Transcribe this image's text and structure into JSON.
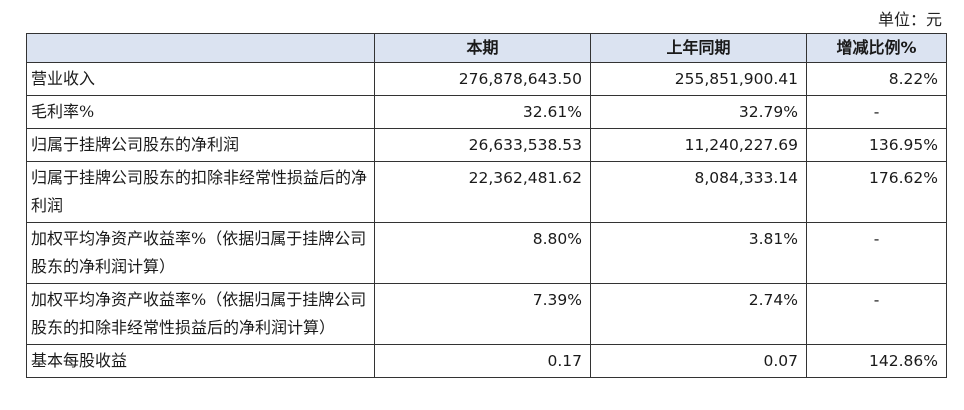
{
  "unit_label": "单位：元",
  "table": {
    "headers": [
      "",
      "本期",
      "上年同期",
      "增减比例%"
    ],
    "rows": [
      {
        "label": "营业收入",
        "current": "276,878,643.50",
        "prior": "255,851,900.41",
        "change": "8.22%"
      },
      {
        "label": "毛利率%",
        "current": "32.61%",
        "prior": "32.79%",
        "change": "-"
      },
      {
        "label": "归属于挂牌公司股东的净利润",
        "current": "26,633,538.53",
        "prior": "11,240,227.69",
        "change": "136.95%"
      },
      {
        "label": "归属于挂牌公司股东的扣除非经常性损益后的净利润",
        "current": "22,362,481.62",
        "prior": "8,084,333.14",
        "change": "176.62%"
      },
      {
        "label": "加权平均净资产收益率%（依据归属于挂牌公司股东的净利润计算）",
        "current": "8.80%",
        "prior": "3.81%",
        "change": "-"
      },
      {
        "label": "加权平均净资产收益率%（依据归属于挂牌公司股东的扣除非经常性损益后的净利润计算）",
        "current": "7.39%",
        "prior": "2.74%",
        "change": "-"
      },
      {
        "label": "基本每股收益",
        "current": "0.17",
        "prior": "0.07",
        "change": "142.86%"
      }
    ]
  }
}
